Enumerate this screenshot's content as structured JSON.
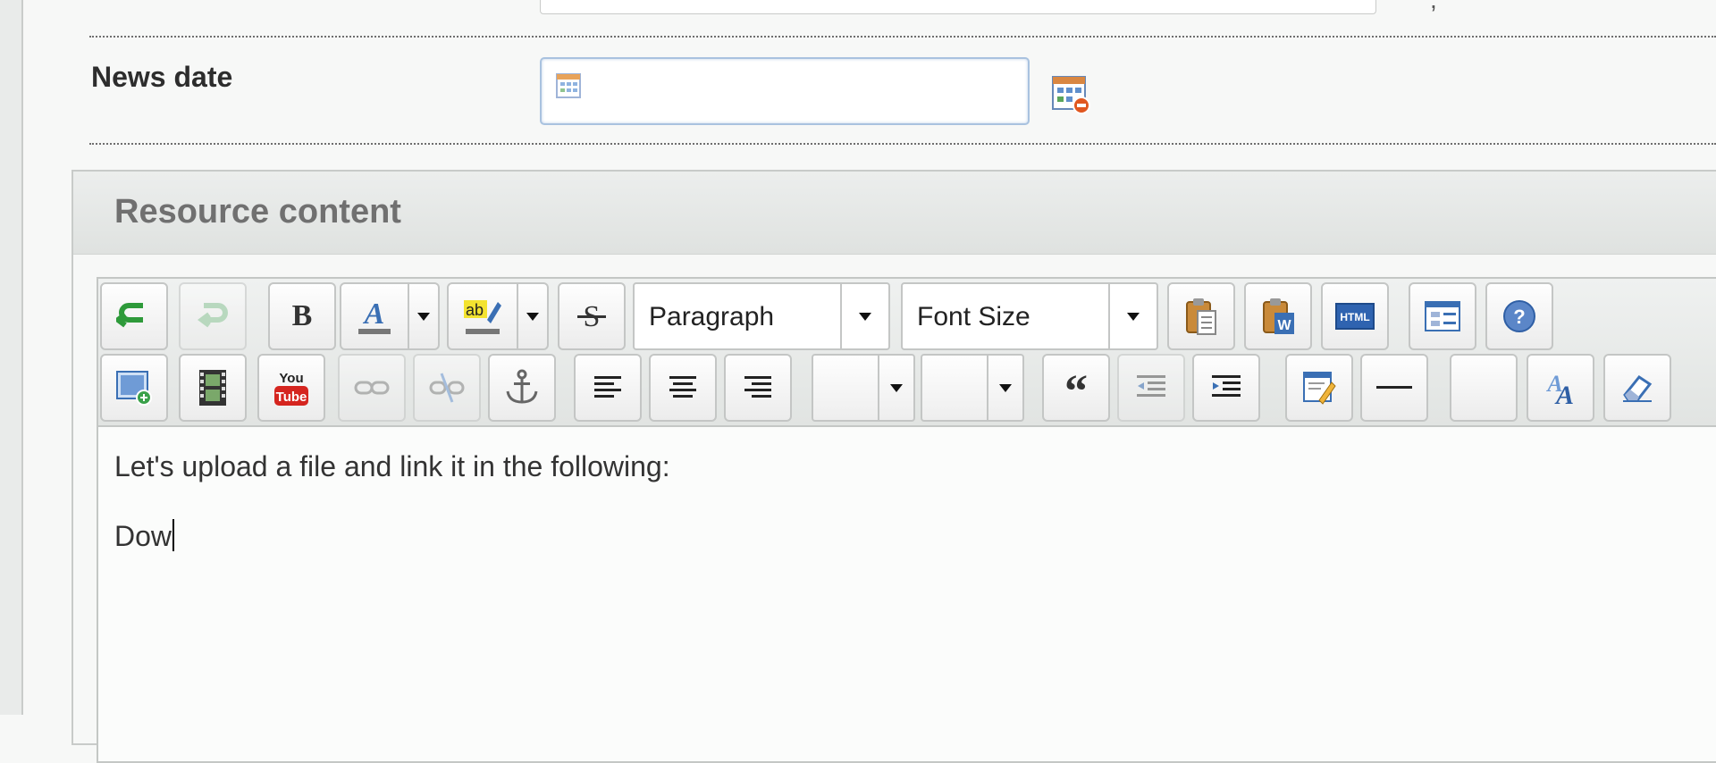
{
  "form": {
    "news_date_label": "News date",
    "news_date_value": ""
  },
  "panel": {
    "title": "Resource content"
  },
  "toolbar": {
    "bold_label": "B",
    "format_select": "Paragraph",
    "fontsize_select": "Font Size",
    "row1_buttons": [
      "undo-icon",
      "redo-icon",
      "bold-icon",
      "font-color-icon",
      "highlight-color-icon",
      "strikethrough-icon",
      "paste-icon",
      "paste-from-word-icon",
      "html-source-icon",
      "template-icon",
      "help-icon"
    ],
    "row2_buttons": [
      "insert-image-icon",
      "insert-media-icon",
      "youtube-icon",
      "link-icon",
      "unlink-icon",
      "anchor-icon",
      "align-left-icon",
      "align-center-icon",
      "align-right-icon",
      "blockquote-icon",
      "outdent-icon",
      "indent-icon",
      "edit-icon",
      "horizontal-rule-icon",
      "font-style-icon",
      "eraser-icon"
    ]
  },
  "editor": {
    "paragraph_1": "Let's upload a file and link it in the following:",
    "paragraph_2": "Dow"
  },
  "colors": {
    "accent_blue": "#3a6fb4",
    "undo_green": "#2e9a3a",
    "youtube_red": "#d5251f"
  }
}
